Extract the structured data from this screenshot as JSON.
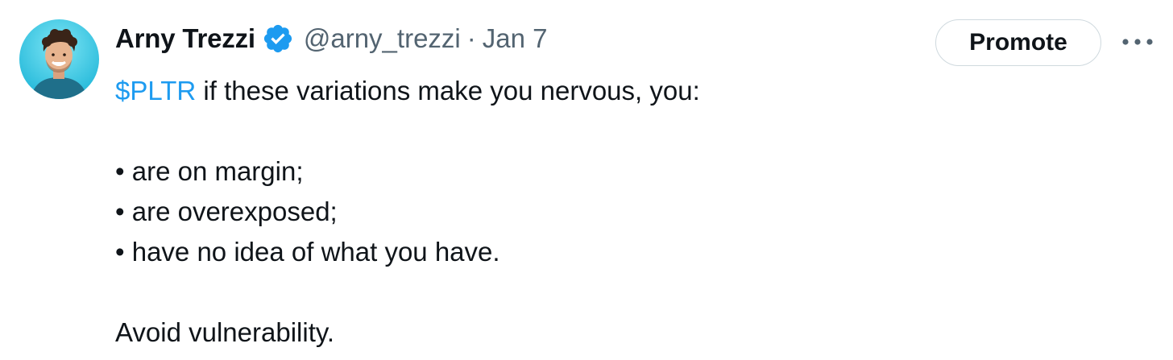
{
  "author": {
    "name": "Arny Trezzi",
    "handle": "@arny_trezzi",
    "separator": "·",
    "date": "Jan 7",
    "verified_icon": "verified-badge-icon",
    "avatar_icon": "avatar"
  },
  "actions": {
    "promote_label": "Promote",
    "more_icon": "more-options-icon"
  },
  "tweet": {
    "cashtag": "$PLTR",
    "intro": " if these variations make you nervous, you:",
    "bullets": [
      "• are on margin;",
      "• are overexposed;",
      "• have no idea of what you have."
    ],
    "closing": "Avoid vulnerability."
  },
  "colors": {
    "accent": "#1d9bf0",
    "text": "#0f1419",
    "secondary_text": "#536471",
    "border": "#cfd9de",
    "avatar_bg": "#2ec7e6"
  }
}
